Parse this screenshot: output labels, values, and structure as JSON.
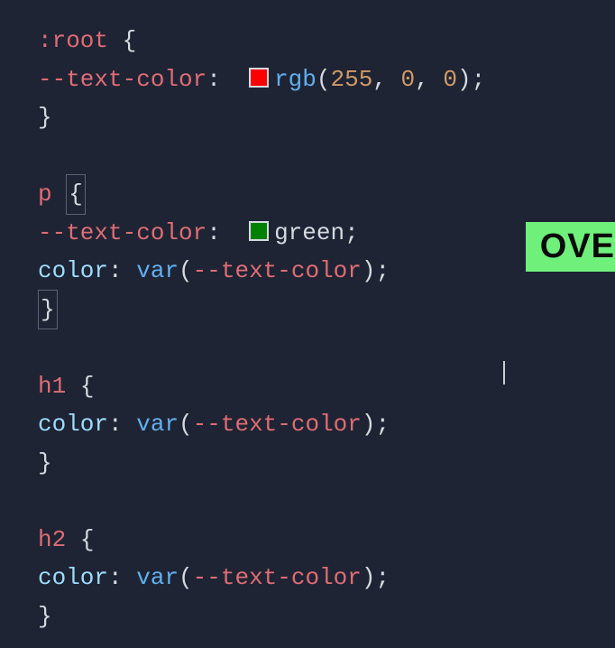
{
  "rules": {
    "root": {
      "selector": ":root",
      "prop": "--text-color",
      "swatch": "#ff0000",
      "value_func": "rgb",
      "value_args": [
        "255",
        "0",
        "0"
      ]
    },
    "p": {
      "selector": "p",
      "prop1": "--text-color",
      "swatch": "#008000",
      "value1": "green",
      "prop2": "color",
      "value2_func": "var",
      "value2_arg": "--text-color"
    },
    "h1": {
      "selector": "h1",
      "prop": "color",
      "value_func": "var",
      "value_arg": "--text-color"
    },
    "h2": {
      "selector": "h2",
      "prop": "color",
      "value_func": "var",
      "value_arg": "--text-color"
    }
  },
  "badge": {
    "label": "OVE"
  },
  "braces": {
    "open": "{",
    "close": "}"
  },
  "punct": {
    "colon": ":",
    "semi": ";",
    "lparen": "(",
    "rparen": ")",
    "comma": ","
  }
}
